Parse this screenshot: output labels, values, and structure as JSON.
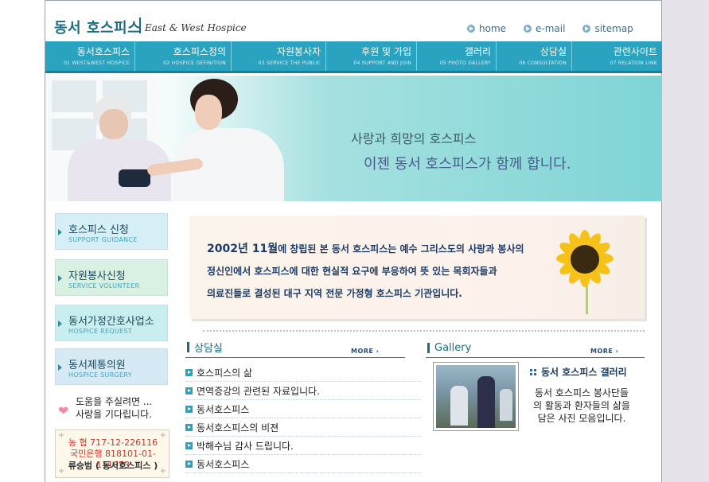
{
  "header": {
    "logo_ko": "동서 호스피스",
    "logo_en": "East & West Hospice",
    "links": [
      {
        "label": "home",
        "icon": "circle-arrow-icon"
      },
      {
        "label": "e-mail",
        "icon": "circle-arrow-icon"
      },
      {
        "label": "sitemap",
        "icon": "circle-arrow-icon"
      }
    ]
  },
  "nav": [
    {
      "ko": "동서호스피스",
      "en": "01 WEST&WEST HOSPICE"
    },
    {
      "ko": "호스피스정의",
      "en": "02 HOSPICE DEFINITION"
    },
    {
      "ko": "자원봉사자",
      "en": "03 SERVICE THE PUBLIC"
    },
    {
      "ko": "후원 및 가입",
      "en": "04 SUPPORT AND JOIN"
    },
    {
      "ko": "갤러리",
      "en": "05 PHOTO GALLERY"
    },
    {
      "ko": "상담실",
      "en": "06 CONSULTATION"
    },
    {
      "ko": "관련사이트",
      "en": "07 RELATION LINK"
    }
  ],
  "banner": {
    "line1": "사랑과 희망의 호스피스",
    "line2": "이젠 동서 호스피스가 함께 합니다."
  },
  "left_menu": [
    {
      "ko": "호스피스 신청",
      "en": "SUPPORT GUIDANCE"
    },
    {
      "ko": "자원봉사신청",
      "en": "SERVICE VOLUNTEER"
    },
    {
      "ko": "동서가정간호사업소",
      "en": "HOSPICE REQUEST"
    },
    {
      "ko": "동서제통의원",
      "en": "HOSPICE SURGERY"
    }
  ],
  "help": {
    "line1": "도움을 주실려면 ...",
    "line2": "사랑을 기다립니다."
  },
  "bank": {
    "line1": "농 협    717-12-226116",
    "line2": "국민은행 818101-01-111073",
    "line3": "류승범 ( 동서호스피스 )"
  },
  "intro": {
    "year": "2002년 11월",
    "rest1": "에 창립된 본 동서 호스피스는 예수 그리스도의 사랑과 봉사의",
    "line2": "정신인에서 호스피스에 대한 현실적 요구에 부응하여 뜻 있는 목회자들과",
    "line3": "의료진들로 결성된 대구 지역 전문 가정형 호스피스 기관입니다."
  },
  "consult": {
    "title": "상담실",
    "more": "MORE",
    "items": [
      "호스피스의 삶",
      "면역증강의 관련된 자료입니다.",
      "동서호스피스",
      "동서호스피스의 비젼",
      "박해수님 감사 드립니다.",
      "동서호스피스"
    ]
  },
  "gallery": {
    "title": "Gallery",
    "more": "MORE",
    "heading": "동서 호스피스 갤러리",
    "desc1": "동서 호스피스 봉사단들",
    "desc2": "의 활동과 환자들의 삶을",
    "desc3": "담은 사진 모음입니다."
  },
  "colors": {
    "nav_bg": "#2aa3c0",
    "brand": "#1a6b85",
    "sidebar_gray": "#e6e4ea"
  }
}
